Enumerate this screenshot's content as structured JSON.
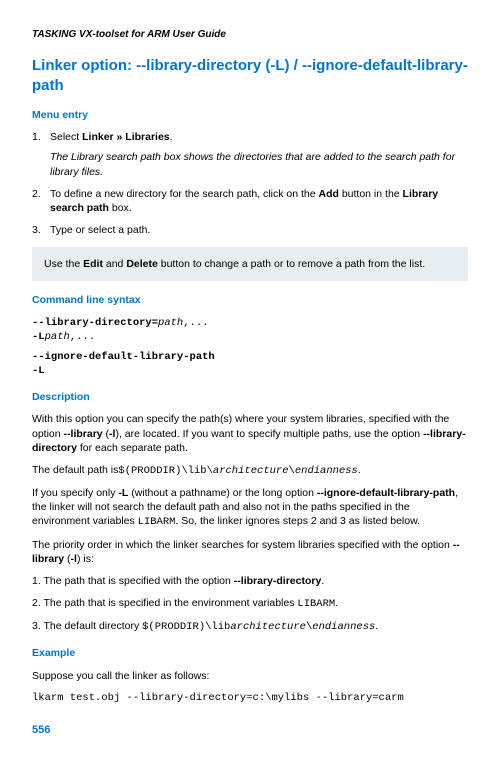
{
  "header_guide": "TASKING VX-toolset for ARM User Guide",
  "page_title": "Linker option: --library-directory (-L) / --ignore-default-library-path",
  "sections": {
    "menu_entry": {
      "heading": "Menu entry",
      "step1_num": "1.",
      "step1_pre": "Select ",
      "step1_bold": "Linker » Libraries",
      "step1_post": ".",
      "step1_note": "The Library search path box shows the directories that are added to the search path for library files.",
      "step2_num": "2.",
      "step2_pre": "To define a new directory for the search path, click on the ",
      "step2_bold1": "Add",
      "step2_mid": " button in the ",
      "step2_bold2": "Library search path",
      "step2_post": " box.",
      "step3_num": "3.",
      "step3_text": "Type or select a path.",
      "note_pre": "Use the ",
      "note_bold1": "Edit",
      "note_mid": " and ",
      "note_bold2": "Delete",
      "note_post": " button to change a path or to remove a path from the list."
    },
    "syntax": {
      "heading": "Command line syntax",
      "line1_a": "--library-directory=",
      "line1_b": "path",
      "line1_c": ",...",
      "line2_a": "-L",
      "line2_b": "path",
      "line2_c": ",...",
      "line3": "--ignore-default-library-path",
      "line4": "-L"
    },
    "description": {
      "heading": "Description",
      "p1_a": "With this option you can specify the path(s) where your system libraries, specified with the option ",
      "p1_b": "--library",
      "p1_c": " (",
      "p1_d": "-l",
      "p1_e": "), are located. If you want to specify multiple paths, use the option ",
      "p1_f": "--library-directory",
      "p1_g": " for each separate path.",
      "p2_a": "The default path is",
      "p2_b": "$(PRODDIR)\\lib\\",
      "p2_c": "architecture",
      "p2_d": "\\",
      "p2_e": "endianness",
      "p2_f": ".",
      "p3_a": "If you specify only ",
      "p3_b": "-L",
      "p3_c": " (without a pathname) or the long option ",
      "p3_d": "--ignore-default-library-path",
      "p3_e": ", the linker will not search the default path and also not in the paths specified in the environment variables ",
      "p3_f": "LIBARM",
      "p3_g": ". So, the linker ignores steps 2 and 3 as listed below.",
      "p4_a": "The priority order in which the linker searches for system libraries specified with the option ",
      "p4_b": "--library",
      "p4_c": " (",
      "p4_d": "-l",
      "p4_e": ") is:",
      "o1_a": "1. The path that is specified with the option ",
      "o1_b": "--library-directory",
      "o1_c": ".",
      "o2_a": "2. The path that is specified in the environment variables ",
      "o2_b": "LIBARM",
      "o2_c": ".",
      "o3_a": "3. The default directory ",
      "o3_b": "$(PRODDIR)\\lib",
      "o3_c": "architecture",
      "o3_d": "\\",
      "o3_e": "endianness",
      "o3_f": "."
    },
    "example": {
      "heading": "Example",
      "p1": "Suppose you call the linker as follows:",
      "code": "lkarm test.obj --library-directory=c:\\mylibs --library=carm"
    }
  },
  "page_number": "556"
}
